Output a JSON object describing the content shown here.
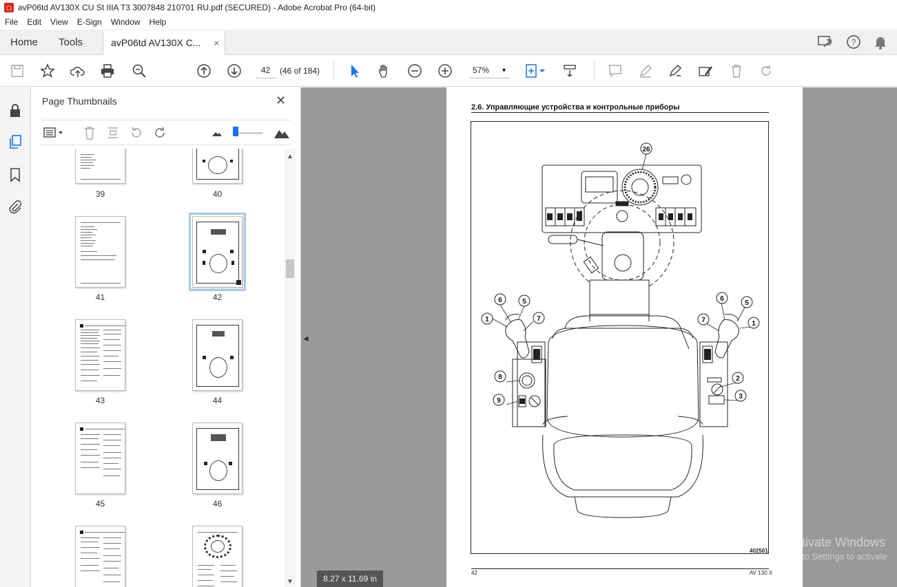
{
  "window": {
    "title": "avP06td AV130X CU St IIIA T3 3007848 210701 RU.pdf (SECURED) - Adobe Acrobat Pro (64-bit)"
  },
  "menu": [
    "File",
    "Edit",
    "View",
    "E-Sign",
    "Window",
    "Help"
  ],
  "tabs": {
    "home": "Home",
    "tools": "Tools",
    "document": "avP06td AV130X C...",
    "close_glyph": "×"
  },
  "toolbar": {
    "page_number": "42",
    "page_count": "(46 of 184)",
    "zoom": "57%"
  },
  "thumbnails_panel": {
    "title": "Page Thumbnails",
    "close_glyph": "✕",
    "pages": [
      "39",
      "40",
      "41",
      "42",
      "43",
      "44",
      "45",
      "46",
      "",
      ""
    ],
    "selected_page": "42"
  },
  "document_page": {
    "section_heading": "2.6.    Управляющие устройства и контрольные приборы",
    "figure_code": "402501",
    "footer_left": "42",
    "footer_right": "AV 130 X",
    "callouts": [
      "26",
      "6",
      "5",
      "1",
      "7",
      "8",
      "9",
      "6",
      "5",
      "7",
      "1",
      "2",
      "3"
    ]
  },
  "status": {
    "page_size": "8.27 x 11.69 in"
  },
  "watermark": {
    "line1": "Activate Windows",
    "line2": "Go to Settings to activate"
  },
  "colors": {
    "accent": "#1473e6",
    "pdf_icon": "#d9261c",
    "viewer_bg": "#9a9a9a"
  }
}
